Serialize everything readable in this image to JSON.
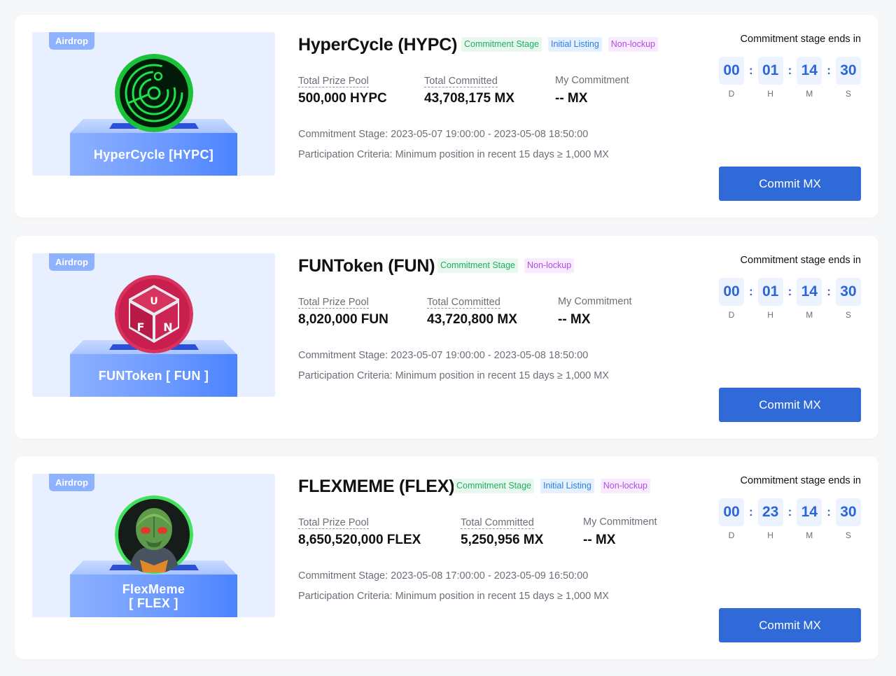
{
  "cards": [
    {
      "badge": "Airdrop",
      "box_label_line1": "HyperCycle [HYPC]",
      "box_label_line2": "",
      "title": "HyperCycle (HYPC)",
      "tags": [
        "Commitment Stage",
        "Initial Listing",
        "Non-lockup"
      ],
      "prize_label": "Total Prize Pool",
      "prize_value": "500,000 HYPC",
      "committed_label": "Total Committed",
      "committed_value": "43,708,175 MX",
      "my_label": "My Commitment",
      "my_value": "-- MX",
      "stage_text": "Commitment Stage: 2023-05-07 19:00:00 - 2023-05-08 18:50:00",
      "criteria_text": "Participation Criteria: Minimum position in recent 15 days ≥ 1,000 MX",
      "ends_label": "Commitment stage ends in",
      "countdown": {
        "d": "00",
        "h": "01",
        "m": "14",
        "s": "30"
      },
      "countdown_labels": {
        "d": "D",
        "h": "H",
        "m": "M",
        "s": "S"
      },
      "button": "Commit MX",
      "coin_icon": "hypercycle-radar-logo"
    },
    {
      "badge": "Airdrop",
      "box_label_line1": "FUNToken [ FUN ]",
      "box_label_line2": "",
      "title": "FUNToken (FUN)",
      "tags": [
        "Commitment Stage",
        "Non-lockup"
      ],
      "prize_label": "Total Prize Pool",
      "prize_value": "8,020,000 FUN",
      "committed_label": "Total Committed",
      "committed_value": "43,720,800 MX",
      "my_label": "My Commitment",
      "my_value": "-- MX",
      "stage_text": "Commitment Stage: 2023-05-07 19:00:00 - 2023-05-08 18:50:00",
      "criteria_text": "Participation Criteria: Minimum position in recent 15 days ≥ 1,000 MX",
      "ends_label": "Commitment stage ends in",
      "countdown": {
        "d": "00",
        "h": "01",
        "m": "14",
        "s": "30"
      },
      "countdown_labels": {
        "d": "D",
        "h": "H",
        "m": "M",
        "s": "S"
      },
      "button": "Commit MX",
      "coin_icon": "funtoken-cube-logo"
    },
    {
      "badge": "Airdrop",
      "box_label_line1": "FlexMeme",
      "box_label_line2": "[ FLEX ]",
      "title": "FLEXMEME (FLEX)",
      "tags": [
        "Commitment Stage",
        "Initial Listing",
        "Non-lockup"
      ],
      "prize_label": "Total Prize Pool",
      "prize_value": "8,650,520,000 FLEX",
      "committed_label": "Total Committed",
      "committed_value": "5,250,956 MX",
      "my_label": "My Commitment",
      "my_value": "-- MX",
      "stage_text": "Commitment Stage: 2023-05-08 17:00:00 - 2023-05-09 16:50:00",
      "criteria_text": "Participation Criteria: Minimum position in recent 15 days ≥ 1,000 MX",
      "ends_label": "Commitment stage ends in",
      "countdown": {
        "d": "00",
        "h": "23",
        "m": "14",
        "s": "30"
      },
      "countdown_labels": {
        "d": "D",
        "h": "H",
        "m": "M",
        "s": "S"
      },
      "button": "Commit MX",
      "coin_icon": "flexmeme-alien-logo"
    }
  ],
  "colors": {
    "primary_button": "#2f6ad8",
    "countdown_text": "#2a66d6",
    "tag_green": "#1fae60",
    "tag_blue": "#2a7ee6",
    "tag_purple": "#b24ce0"
  }
}
